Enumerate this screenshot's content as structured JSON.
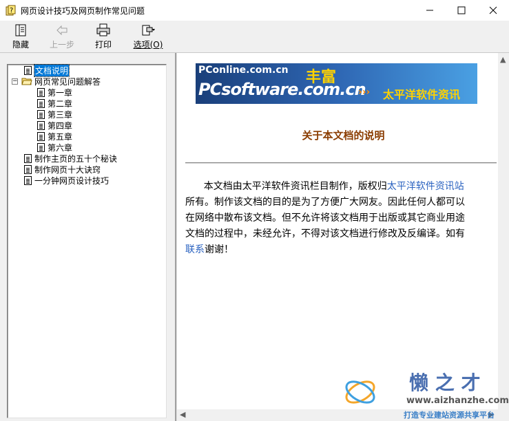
{
  "window": {
    "title": "网页设计技巧及网页制作常见问题",
    "controls": {
      "minimize": "—",
      "maximize": "☐",
      "close": "✕"
    }
  },
  "toolbar": {
    "hide_label": "隐藏",
    "back_label": "上一步",
    "print_label": "打印",
    "options_label": "选项(O)"
  },
  "tree": {
    "items": [
      {
        "label": "文档说明"
      },
      {
        "label": "网页常见问题解答"
      },
      {
        "label": "第一章"
      },
      {
        "label": "第二章"
      },
      {
        "label": "第三章"
      },
      {
        "label": "第四章"
      },
      {
        "label": "第五章"
      },
      {
        "label": "第六章"
      },
      {
        "label": "制作主页的五十个秘诀"
      },
      {
        "label": "制作网页十大诀窍"
      },
      {
        "label": "一分钟网页设计技巧"
      }
    ],
    "expander": "−"
  },
  "content": {
    "banner": {
      "line1": "PConline.com.cn",
      "line2": "PCsoftware.com.cn",
      "feng": "丰富",
      "slogan": "太平洋软件资讯",
      "arrows": "›››"
    },
    "doc_title": "关于本文档的说明",
    "p1a": "      本文档由太平洋软件资讯栏目制作，版权归",
    "p1_link": "太平洋软件资讯站",
    "p2": "所有。制作该文档的目的是为了方便广大网友。因此任何人都可以",
    "p3": "在网络中散布该文档。但不允许将该文档用于出版或其它商业用途",
    "p4": "文档的过程中，未经允许，不得对该文档进行修改及反编译。如有",
    "p5_link": "联系",
    "p5b": "谢谢！"
  },
  "watermark": {
    "brand": "懒 之 才",
    "url": "www.aizhanzhe.com",
    "slogan": "打造专业建站资源共享平台"
  }
}
